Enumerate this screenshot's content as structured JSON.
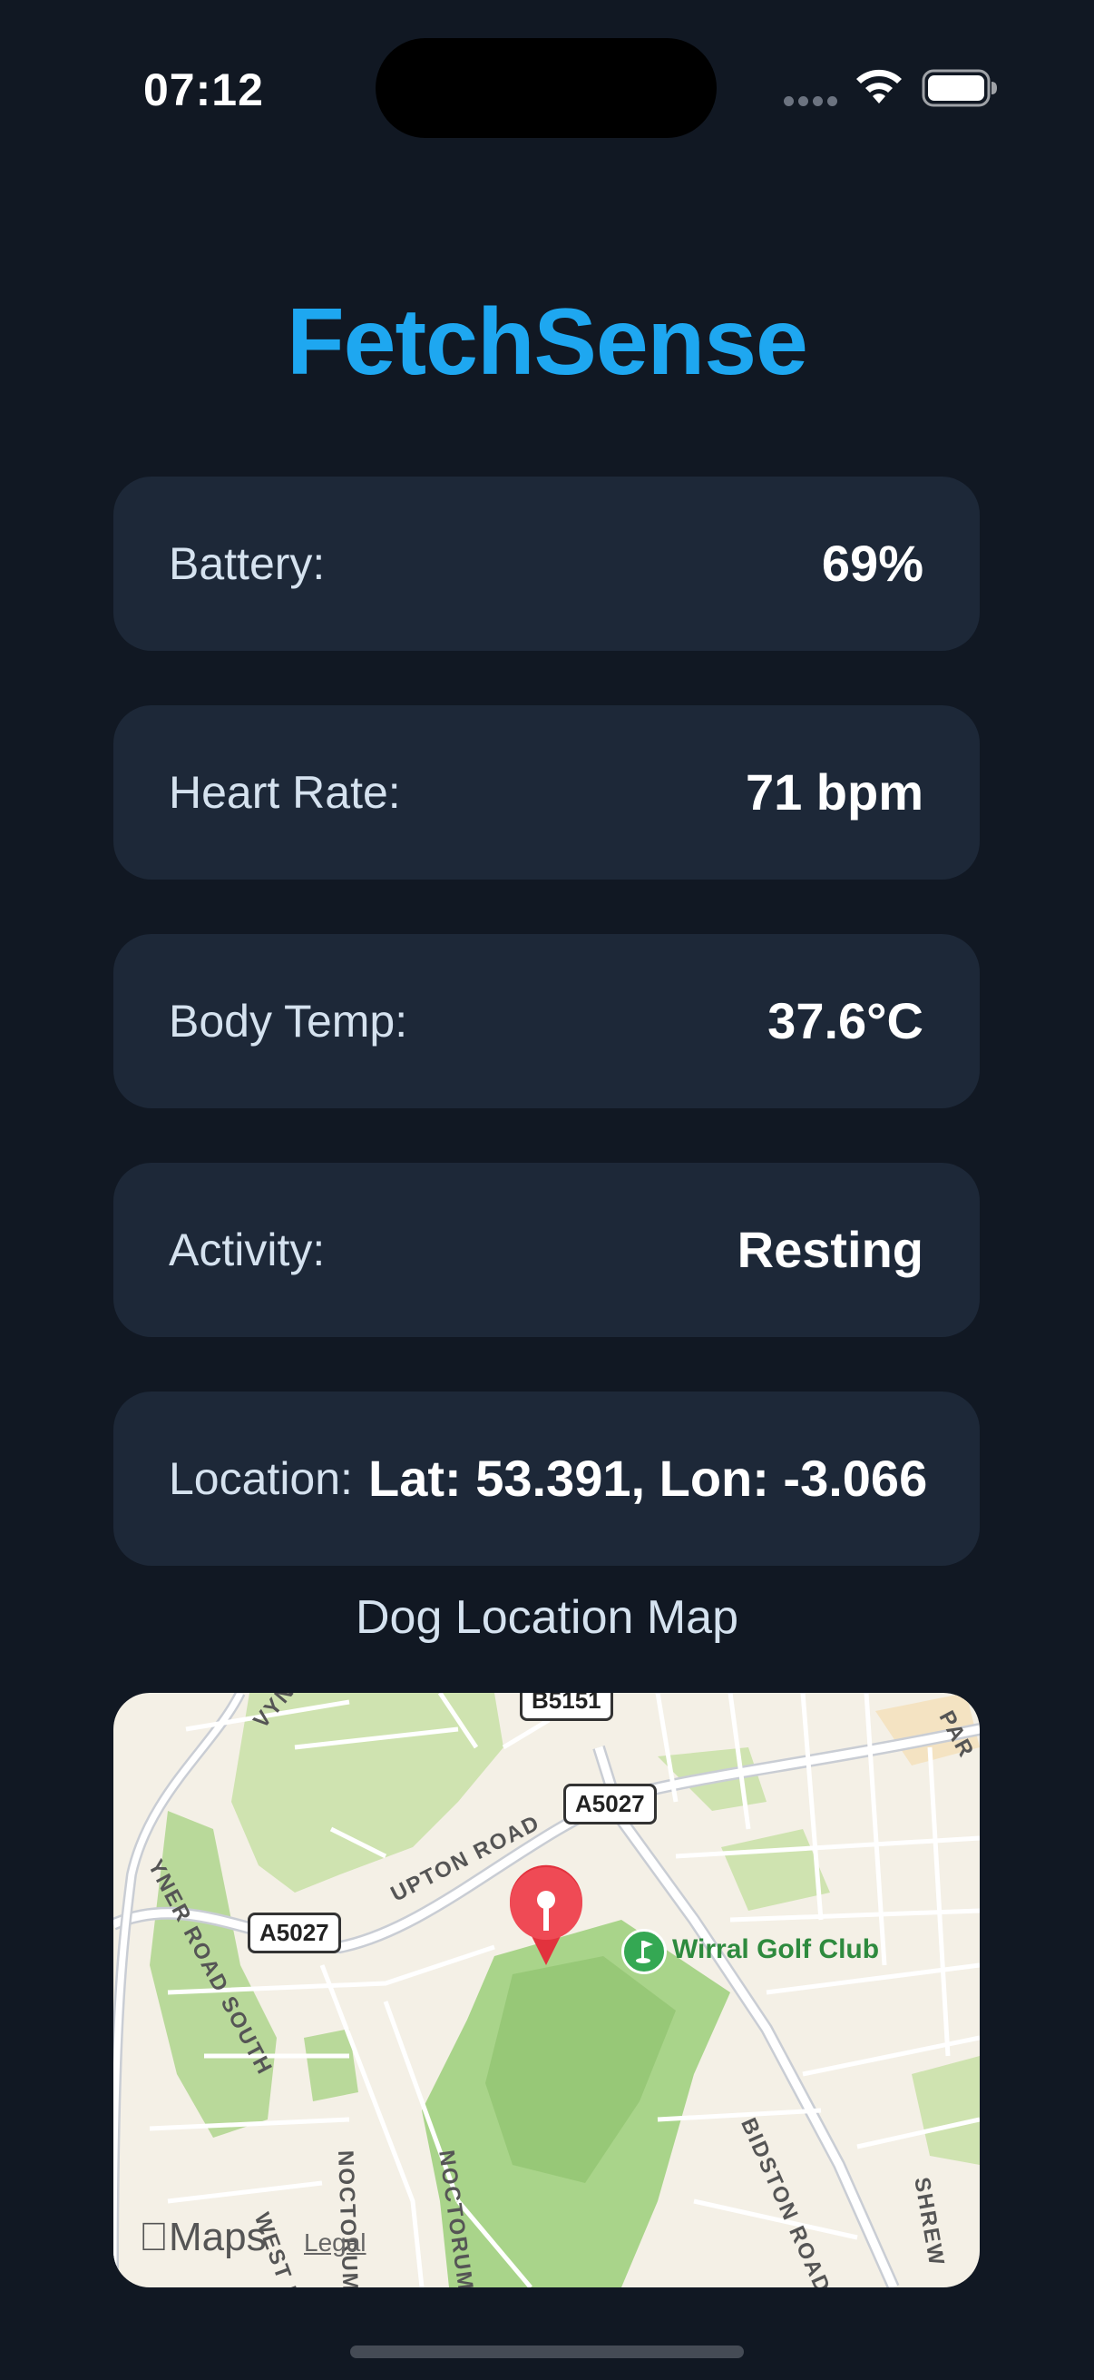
{
  "status_bar": {
    "time": "07:12",
    "icons": [
      "signal-dots-icon",
      "wifi-icon",
      "battery-icon"
    ]
  },
  "app": {
    "title": "FetchSense",
    "accent_color": "#1ea7f0"
  },
  "metrics": [
    {
      "label": "Battery:",
      "value": "69%"
    },
    {
      "label": "Heart Rate:",
      "value": "71 bpm"
    },
    {
      "label": "Body Temp:",
      "value": "37.6°C"
    },
    {
      "label": "Activity:",
      "value": "Resting"
    },
    {
      "label": "Location:",
      "value": "Lat: 53.391, Lon: -3.066"
    }
  ],
  "map": {
    "caption": "Dog Location Map",
    "labels": {
      "golf_club": "Wirral Golf Club",
      "upton_road": "UPTON ROAD",
      "bidston_road": "BIDSTON ROAD",
      "ryner_road_south": "YNER ROAD SOUTH",
      "noctorum_1": "NOCTORUM RO",
      "noctorum_2": "NOCTORUM",
      "west": "WEST R",
      "shrew": "SHREW",
      "park": "PAR",
      "vyn": "VYN"
    },
    "shields": [
      "A5027",
      "A5027",
      "B5151"
    ],
    "attribution": {
      "logo": "Maps",
      "legal": "Legal"
    }
  }
}
